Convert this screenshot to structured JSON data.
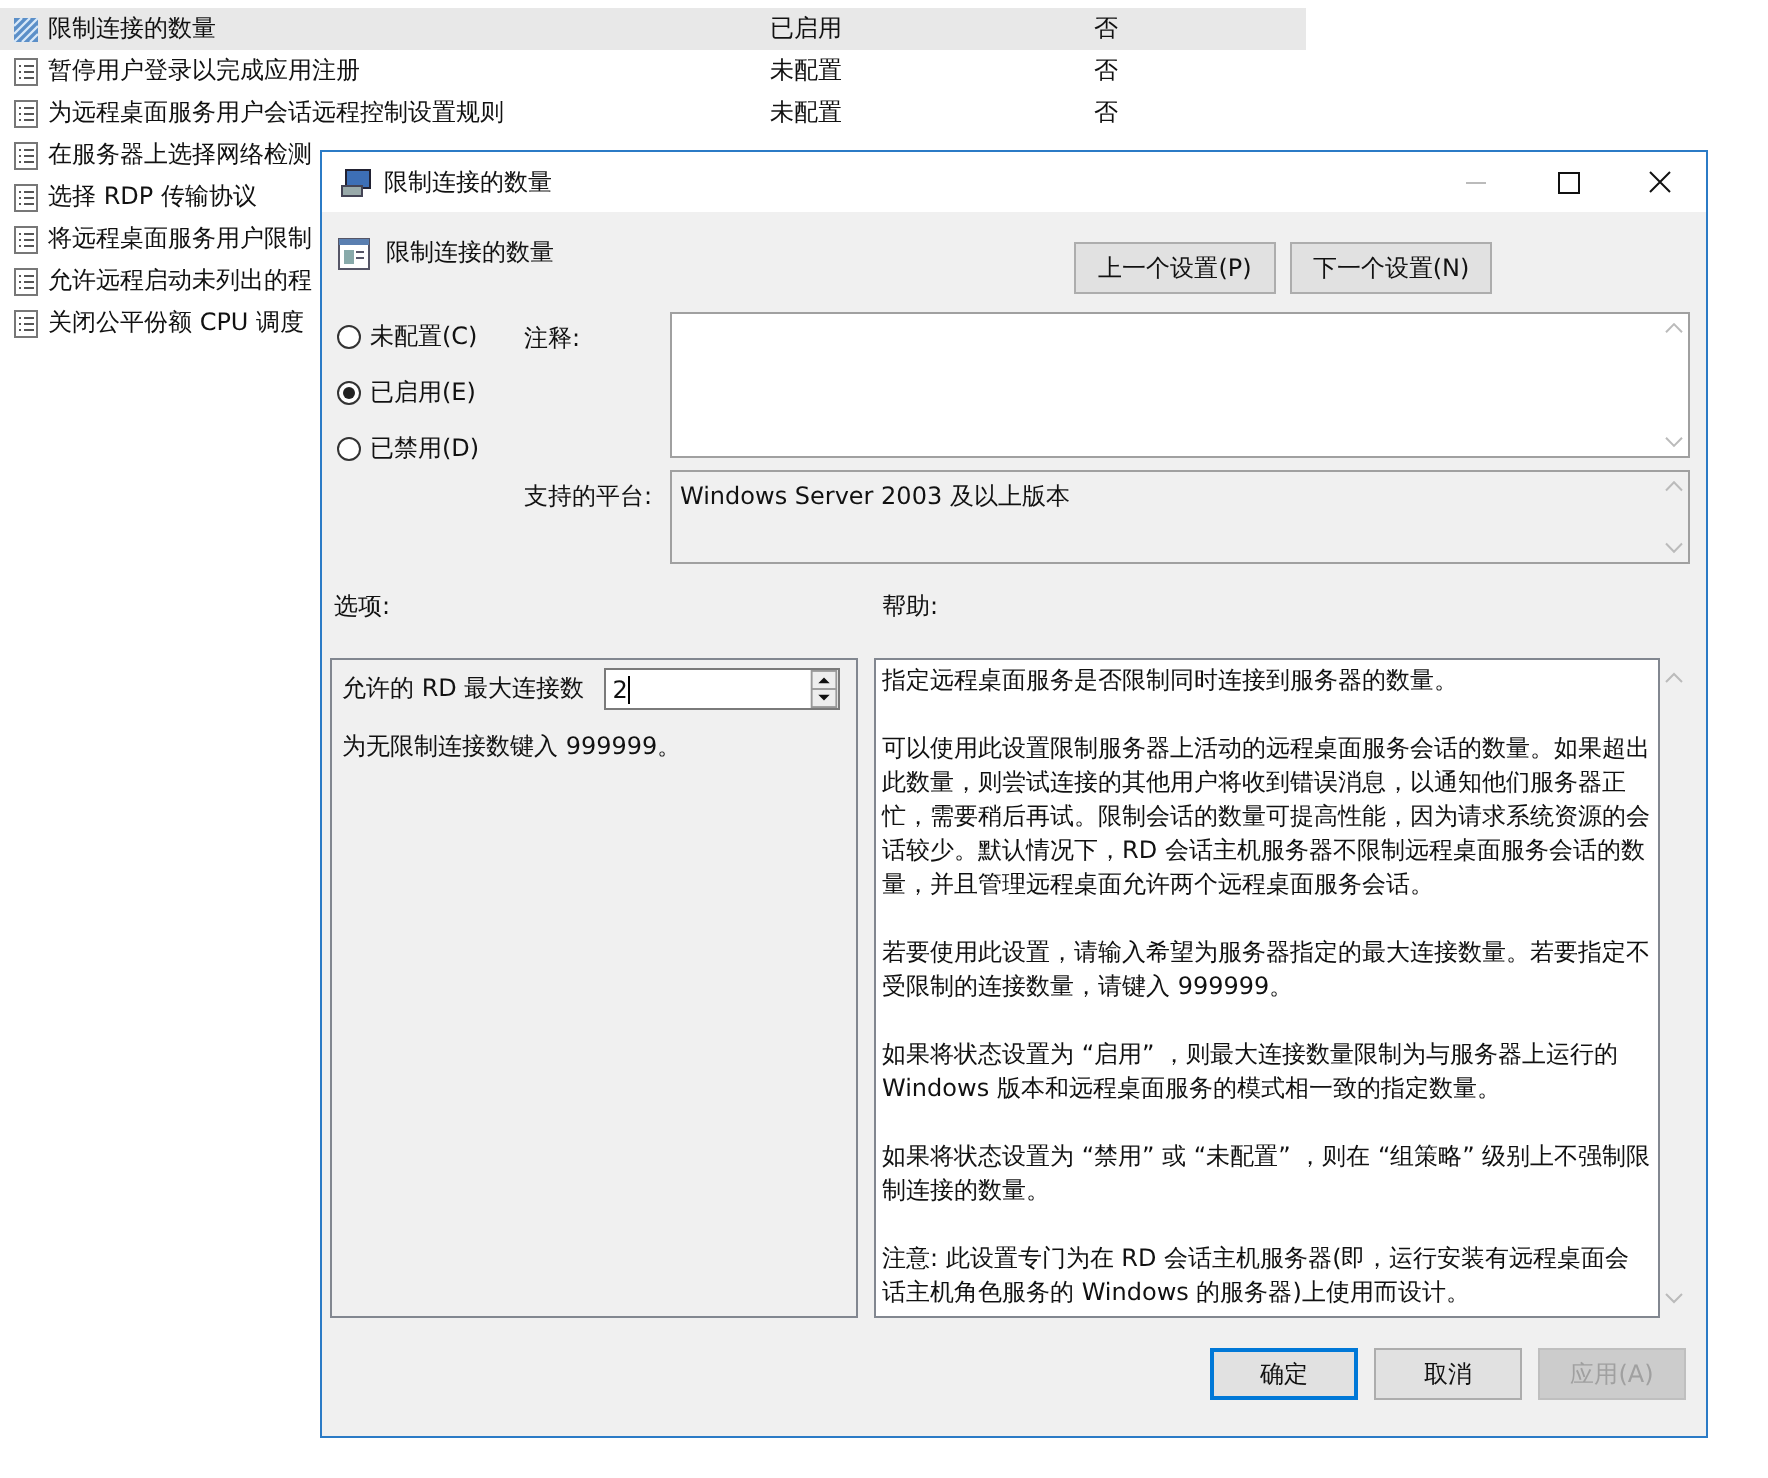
{
  "policy_list": {
    "rows": [
      {
        "name": "限制连接的数量",
        "state": "已启用",
        "column_3": "否",
        "selected": true
      },
      {
        "name": "暂停用户登录以完成应用注册",
        "state": "未配置",
        "column_3": "否",
        "selected": false
      },
      {
        "name": "为远程桌面服务用户会话远程控制设置规则",
        "state": "未配置",
        "column_3": "否",
        "selected": false
      },
      {
        "name": "在服务器上选择网络检测",
        "selected": false
      },
      {
        "name": "选择 RDP 传输协议",
        "selected": false
      },
      {
        "name": "将远程桌面服务用户限制",
        "selected": false
      },
      {
        "name": "允许远程启动未列出的程",
        "selected": false
      },
      {
        "name": "关闭公平份额 CPU 调度",
        "selected": false
      }
    ]
  },
  "dialog": {
    "title": "限制连接的数量",
    "setting_name": "限制连接的数量",
    "prev_button": "上一个设置(P)",
    "next_button": "下一个设置(N)",
    "states": [
      {
        "label": "未配置(C)",
        "selected": false
      },
      {
        "label": "已启用(E)",
        "selected": true
      },
      {
        "label": "已禁用(D)",
        "selected": false
      }
    ],
    "comment_label": "注释:",
    "platform_label": "支持的平台:",
    "platform": "Windows Server 2003 及以上版本",
    "options_label": "选项:",
    "help_label": "帮助:",
    "options": {
      "spin_label": "允许的 RD 最大连接数",
      "spin_value": "2",
      "hint": "为无限制连接数键入 999999。"
    },
    "help": [
      "指定远程桌面服务是否限制同时连接到服务器的数量。",
      "可以使用此设置限制服务器上活动的远程桌面服务会话的数量。如果超出此数量，则尝试连接的其他用户将收到错误消息，以通知他们服务器正忙，需要稍后再试。限制会话的数量可提高性能，因为请求系统资源的会话较少。默认情况下，RD 会话主机服务器不限制远程桌面服务会话的数量，并且管理远程桌面允许两个远程桌面服务会话。",
      "若要使用此设置，请输入希望为服务器指定的最大连接数量。若要指定不受限制的连接数量，请键入 999999。",
      "如果将状态设置为 “启用” ，则最大连接数量限制为与服务器上运行的 Windows 版本和远程桌面服务的模式相一致的指定数量。",
      "如果将状态设置为 “禁用” 或 “未配置” ，则在 “组策略” 级别上不强制限制连接的数量。",
      "注意: 此设置专门为在 RD 会话主机服务器(即，运行安装有远程桌面会话主机角色服务的 Windows 的服务器)上使用而设计。"
    ],
    "buttons": [
      {
        "label": "确定",
        "kind": "default",
        "disabled": false
      },
      {
        "label": "取消",
        "kind": "normal",
        "disabled": false
      },
      {
        "label": "应用(A)",
        "kind": "normal",
        "disabled": true
      }
    ]
  }
}
